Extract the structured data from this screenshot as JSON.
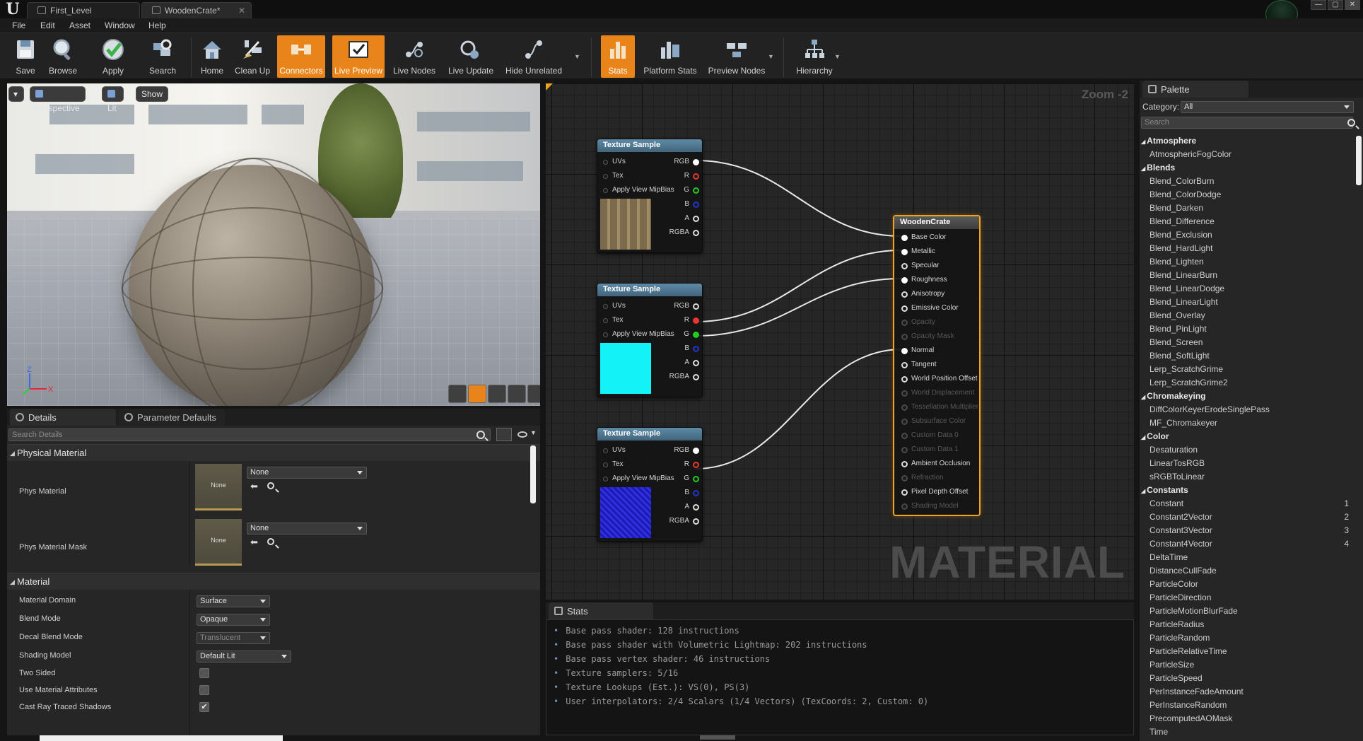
{
  "title_tabs": [
    {
      "label": "First_Level"
    },
    {
      "label": "WoodenCrate*",
      "close": "✕"
    }
  ],
  "window_controls": {
    "minimize": "—",
    "maximize": "▢",
    "close": "✕"
  },
  "menu": [
    "File",
    "Edit",
    "Asset",
    "Window",
    "Help"
  ],
  "toolbar": {
    "save": "Save",
    "browse": "Browse",
    "apply": "Apply",
    "search": "Search",
    "home": "Home",
    "cleanup": "Clean Up",
    "connectors": "Connectors",
    "live_preview": "Live Preview",
    "live_nodes": "Live Nodes",
    "live_update": "Live Update",
    "hide_unrelated": "Hide Unrelated",
    "stats": "Stats",
    "platform_stats": "Platform Stats",
    "preview_nodes": "Preview Nodes",
    "hierarchy": "Hierarchy"
  },
  "viewport": {
    "perspective": "Perspective",
    "lit": "Lit",
    "show": "Show",
    "axis_x": "X",
    "axis_z": "Z"
  },
  "details": {
    "tab_details": "Details",
    "tab_params": "Parameter Defaults",
    "search_placeholder": "Search Details",
    "physical_material": {
      "title": "Physical Material",
      "phys_material_label": "Phys Material",
      "phys_material_value": "None",
      "phys_material_thumb": "None",
      "phys_mask_label": "Phys Material Mask",
      "phys_mask_value": "None",
      "phys_mask_thumb": "None"
    },
    "material": {
      "title": "Material",
      "domain_label": "Material Domain",
      "domain_value": "Surface",
      "blend_label": "Blend Mode",
      "blend_value": "Opaque",
      "decal_label": "Decal Blend Mode",
      "decal_value": "Translucent",
      "shading_label": "Shading Model",
      "shading_value": "Default Lit",
      "two_sided_label": "Two Sided",
      "two_sided": false,
      "use_attr_label": "Use Material Attributes",
      "use_attr": false,
      "ray_shadows_label": "Cast Ray Traced Shadows",
      "ray_shadows": true
    }
  },
  "graph": {
    "zoom": "Zoom -2",
    "watermark": "MATERIAL",
    "texture_nodes": [
      {
        "title": "Texture Sample",
        "preview": "wood"
      },
      {
        "title": "Texture Sample",
        "preview": "cyan"
      },
      {
        "title": "Texture Sample",
        "preview": "normal"
      }
    ],
    "tex_inputs": [
      "UVs",
      "Tex",
      "Apply View MipBias"
    ],
    "tex_outputs": [
      "RGB",
      "R",
      "G",
      "B",
      "A",
      "RGBA"
    ],
    "material_node": {
      "title": "WoodenCrate",
      "pins": [
        "Base Color",
        "Metallic",
        "Specular",
        "Roughness",
        "Anisotropy",
        "Emissive Color",
        "Opacity",
        "Opacity Mask",
        "Normal",
        "Tangent",
        "World Position Offset",
        "World Displacement",
        "Tessellation Multiplier",
        "Subsurface Color",
        "Custom Data 0",
        "Custom Data 1",
        "Ambient Occlusion",
        "Refraction",
        "Pixel Depth Offset",
        "Shading Model"
      ],
      "disabled": [
        6,
        7,
        11,
        12,
        13,
        14,
        15,
        17,
        19
      ],
      "connected": [
        0,
        1,
        3,
        8
      ]
    }
  },
  "stats": {
    "tab": "Stats",
    "lines": [
      "Base pass shader: 128 instructions",
      "Base pass shader with Volumetric Lightmap: 202 instructions",
      "Base pass vertex shader: 46 instructions",
      "Texture samplers: 5/16",
      "Texture Lookups (Est.): VS(0), PS(3)",
      "User interpolators: 2/4 Scalars (1/4 Vectors) (TexCoords: 2, Custom: 0)"
    ]
  },
  "palette": {
    "tab": "Palette",
    "category_label": "Category:",
    "category_value": "All",
    "search_placeholder": "Search",
    "groups": [
      {
        "name": "Atmosphere",
        "items": [
          {
            "label": "AtmosphericFogColor"
          }
        ]
      },
      {
        "name": "Blends",
        "items": [
          {
            "label": "Blend_ColorBurn"
          },
          {
            "label": "Blend_ColorDodge"
          },
          {
            "label": "Blend_Darken"
          },
          {
            "label": "Blend_Difference"
          },
          {
            "label": "Blend_Exclusion"
          },
          {
            "label": "Blend_HardLight"
          },
          {
            "label": "Blend_Lighten"
          },
          {
            "label": "Blend_LinearBurn"
          },
          {
            "label": "Blend_LinearDodge"
          },
          {
            "label": "Blend_LinearLight"
          },
          {
            "label": "Blend_Overlay"
          },
          {
            "label": "Blend_PinLight"
          },
          {
            "label": "Blend_Screen"
          },
          {
            "label": "Blend_SoftLight"
          },
          {
            "label": "Lerp_ScratchGrime"
          },
          {
            "label": "Lerp_ScratchGrime2"
          }
        ]
      },
      {
        "name": "Chromakeying",
        "items": [
          {
            "label": "DiffColorKeyerErodeSinglePass"
          },
          {
            "label": "MF_Chromakeyer"
          }
        ]
      },
      {
        "name": "Color",
        "items": [
          {
            "label": "Desaturation"
          },
          {
            "label": "LinearTosRGB"
          },
          {
            "label": "sRGBToLinear"
          }
        ]
      },
      {
        "name": "Constants",
        "items": [
          {
            "label": "Constant",
            "key": "1"
          },
          {
            "label": "Constant2Vector",
            "key": "2"
          },
          {
            "label": "Constant3Vector",
            "key": "3"
          },
          {
            "label": "Constant4Vector",
            "key": "4"
          },
          {
            "label": "DeltaTime"
          },
          {
            "label": "DistanceCullFade"
          },
          {
            "label": "ParticleColor"
          },
          {
            "label": "ParticleDirection"
          },
          {
            "label": "ParticleMotionBlurFade"
          },
          {
            "label": "ParticleRadius"
          },
          {
            "label": "ParticleRandom"
          },
          {
            "label": "ParticleRelativeTime"
          },
          {
            "label": "ParticleSize"
          },
          {
            "label": "ParticleSpeed"
          },
          {
            "label": "PerInstanceFadeAmount"
          },
          {
            "label": "PerInstanceRandom"
          },
          {
            "label": "PrecomputedAOMask"
          },
          {
            "label": "Time"
          }
        ]
      }
    ]
  },
  "colors": {
    "accent": "#e8841a",
    "node_header": "#4f7893",
    "selected_border": "#f0a31e"
  }
}
